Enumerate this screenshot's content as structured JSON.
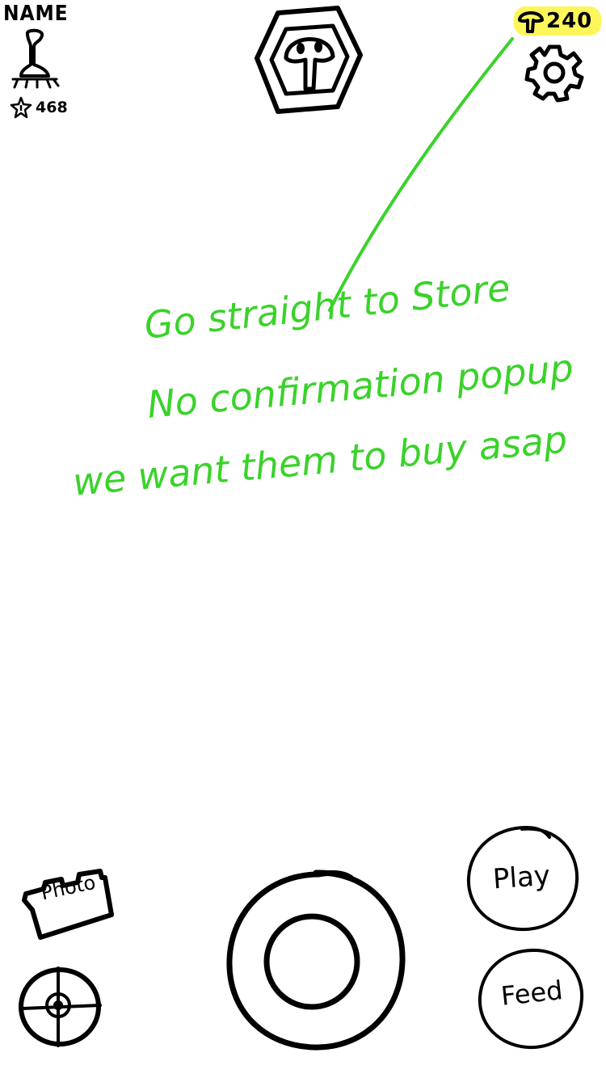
{
  "header": {
    "player_name": "NAME",
    "star_count": "468",
    "currency_amount": "240"
  },
  "annotation": {
    "line1": "Go straight to Store",
    "line2": "No confirmation popup",
    "line3": "we want them to buy asap",
    "color": "#3ad22a",
    "highlight_color": "#fdf65a"
  },
  "buttons": {
    "photo_label": "Photo",
    "play_label": "Play",
    "feed_label": "Feed"
  }
}
